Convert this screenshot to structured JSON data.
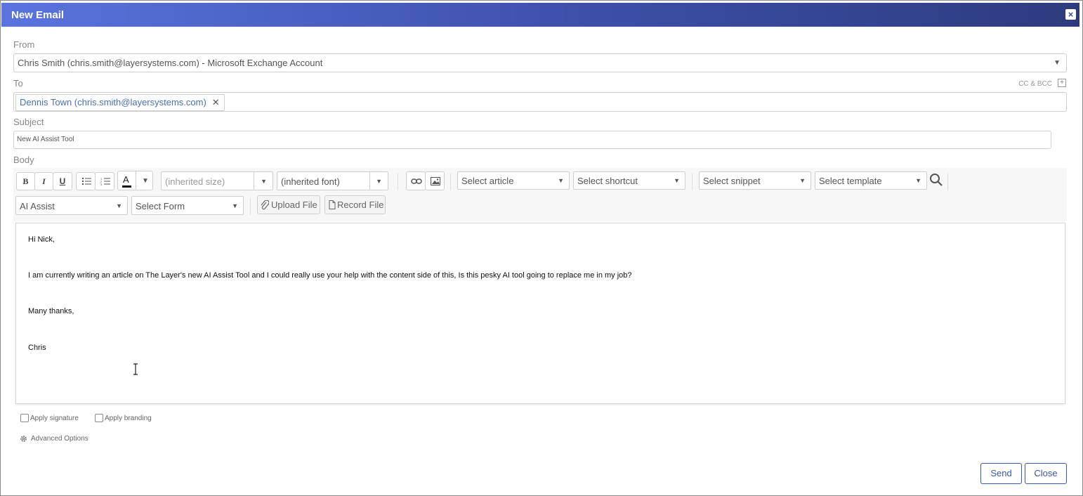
{
  "window": {
    "title": "New Email"
  },
  "from": {
    "label": "From",
    "value": "Chris Smith (chris.smith@layersystems.com) - Microsoft Exchange Account"
  },
  "to": {
    "label": "To",
    "recipient": "Dennis Town (chris.smith@layersystems.com)",
    "cc_bcc": "CC & BCC"
  },
  "subject": {
    "label": "Subject",
    "value": "New AI Assist Tool"
  },
  "body": {
    "label": "Body",
    "lines": [
      "Hi Nick,",
      "I am currently writing an article on The Layer's new AI Assist Tool and I could really use your help with the content side of this, Is this pesky AI tool going to replace me in my job?",
      "Many thanks,",
      "Chris"
    ]
  },
  "toolbar": {
    "bold": "B",
    "italic": "I",
    "underline": "U",
    "font_color": "A",
    "size": "(inherited size)",
    "font": "(inherited font)",
    "article": "Select article",
    "shortcut": "Select shortcut",
    "snippet": "Select snippet",
    "template": "Select template",
    "ai_assist": "AI Assist",
    "form": "Select Form",
    "upload": "Upload File",
    "record": "Record File"
  },
  "options": {
    "apply_signature": "Apply signature",
    "apply_branding": "Apply branding",
    "advanced": "Advanced Options"
  },
  "actions": {
    "send": "Send",
    "close": "Close"
  }
}
